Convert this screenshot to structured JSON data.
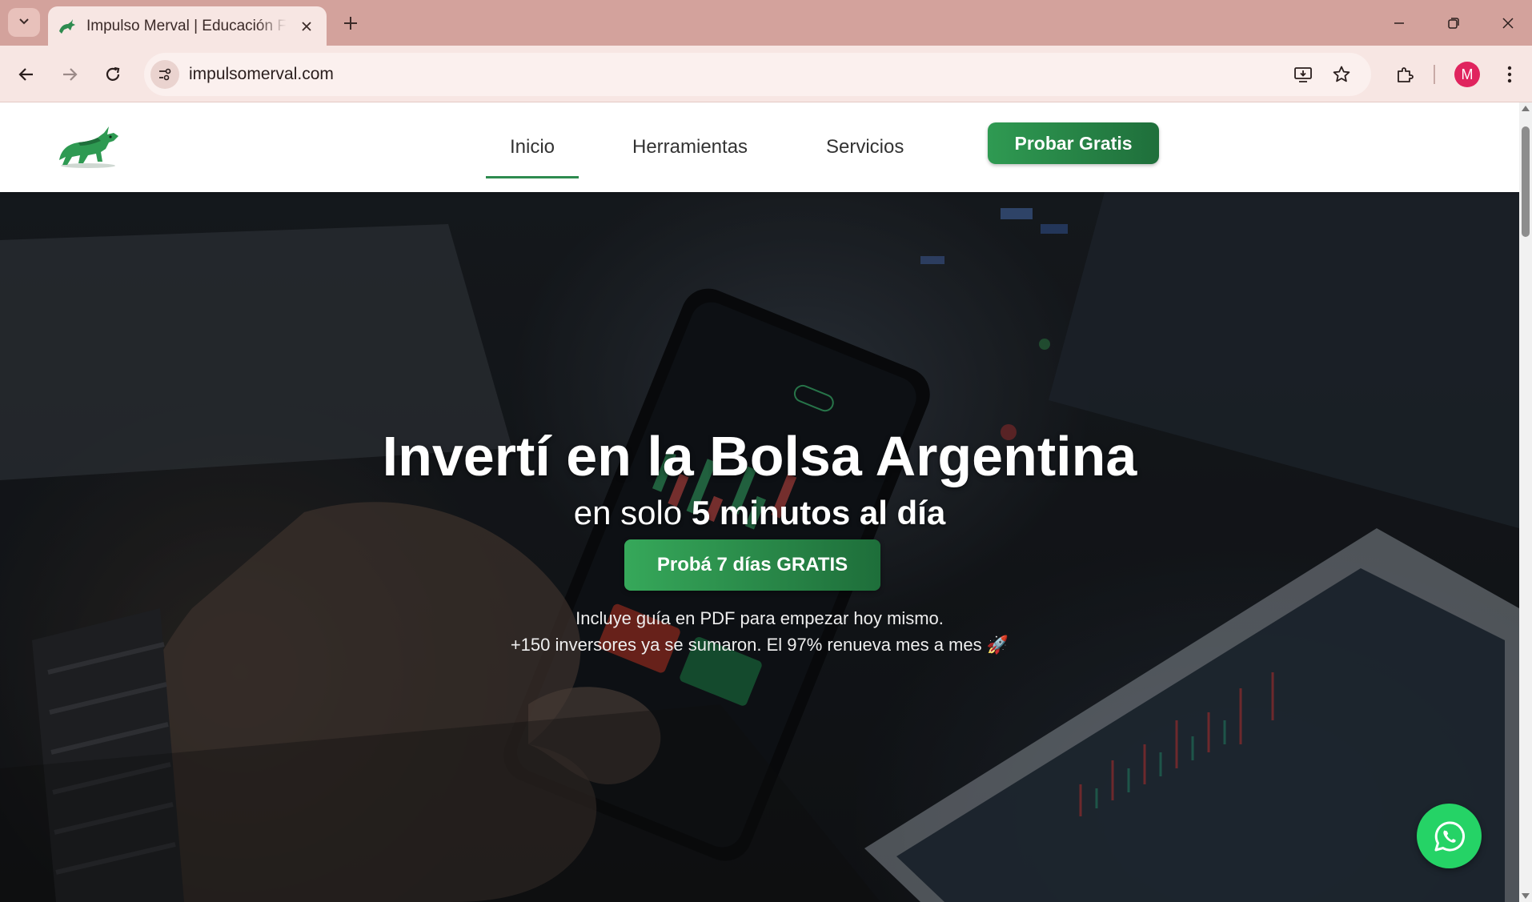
{
  "browser": {
    "tab_title": "Impulso Merval | Educación Financiera",
    "new_tab_label": "+",
    "close_tab_label": "✕",
    "url": "impulsomerval.com",
    "profile_initial": "M",
    "icons": [
      "tab-search-icon",
      "bull-favicon-icon",
      "back-icon",
      "forward-icon",
      "reload-icon",
      "site-info-icon",
      "install-icon",
      "star-icon",
      "extensions-icon",
      "kebab-menu-icon",
      "minimize-icon",
      "restore-icon",
      "close-icon"
    ]
  },
  "site": {
    "nav": {
      "links": [
        "Inicio",
        "Herramientas",
        "Servicios"
      ],
      "active": "Inicio",
      "cta": "Probar Gratis"
    },
    "hero": {
      "title": "Invertí en la Bolsa Argentina",
      "subtitle_prefix": "en solo ",
      "subtitle_bold": "5 minutos al día",
      "cta": "Probá 7 días GRATIS",
      "note1": "Incluye guía en PDF para empezar hoy mismo.",
      "note2": "+150 inversores ya se sumaron. El 97% renueva mes a mes",
      "note2_emoji": "🚀"
    },
    "whatsapp_icon": "whatsapp-icon"
  },
  "colors": {
    "accent_green": "#2e8b4f",
    "whatsapp_green": "#25d366",
    "chrome_tab_bar": "#d3a29c",
    "chrome_toolbar": "#f7e6e3"
  }
}
